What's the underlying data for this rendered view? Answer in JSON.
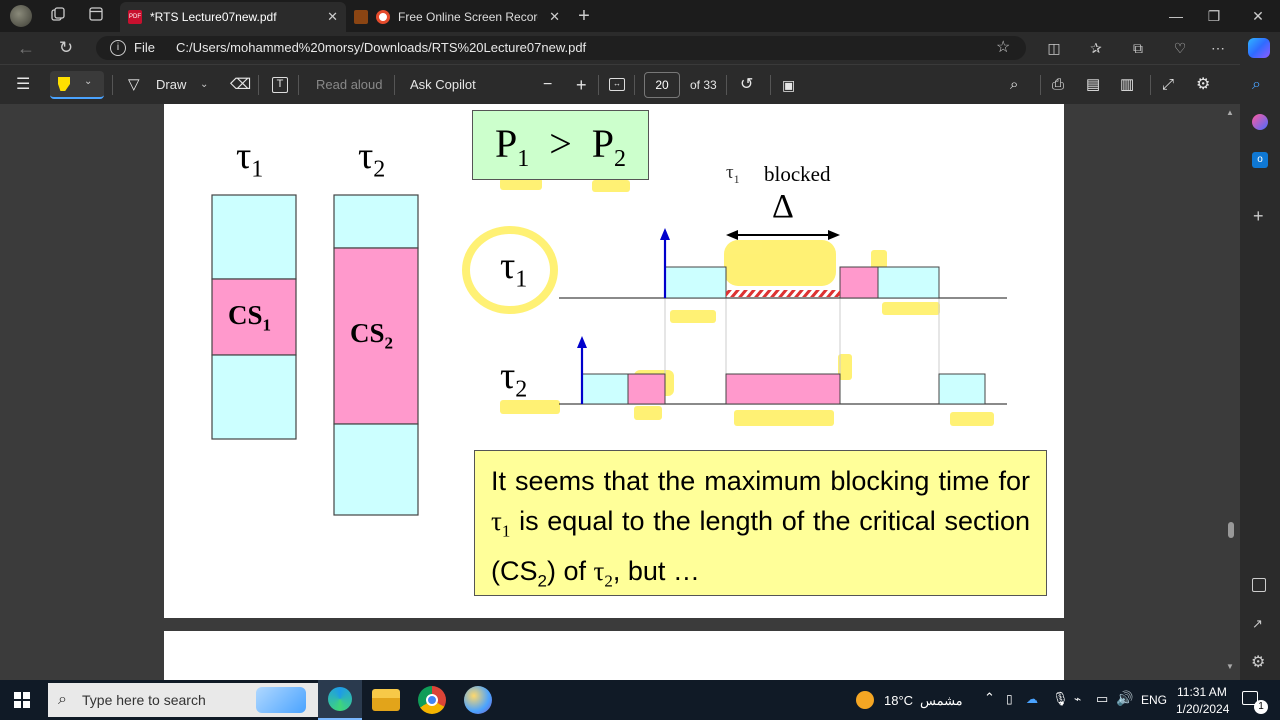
{
  "tabs": [
    {
      "title": "*RTS Lecture07new.pdf",
      "active": true
    },
    {
      "title": "Free Online Screen Recorde",
      "active": false
    }
  ],
  "address": {
    "file_label": "File",
    "url": "C:/Users/mohammed%20morsy/Downloads/RTS%20Lecture07new.pdf"
  },
  "pdf_toolbar": {
    "draw_label": "Draw",
    "read_aloud_label": "Read aloud",
    "ask_copilot_label": "Ask Copilot",
    "zoom_out": "−",
    "zoom_in": "+",
    "current_page": "20",
    "page_total": "of 33"
  },
  "slide": {
    "tau": "τ",
    "sub1": "1",
    "sub2": "2",
    "cs_label": "CS",
    "priority": {
      "p": "P",
      "gt": ">"
    },
    "blocked_label": "blocked",
    "delta": "Δ",
    "text": {
      "part1": "It seems that the maximum blocking time for ",
      "part2": " is equal to the length of the critical section (CS",
      "part3": ") of ",
      "part4": ",  but …"
    }
  },
  "taskbar": {
    "search_placeholder": "Type here to search",
    "weather_temp": "18°C",
    "weather_desc": "مشمس",
    "language": "ENG",
    "time": "11:31 AM",
    "date": "1/20/2024",
    "notification_count": "1"
  },
  "colors": {
    "cyan": "#ccffff",
    "pink": "#ff99cc",
    "highlight": "#fff066",
    "arrow_blue": "#0000cc"
  }
}
